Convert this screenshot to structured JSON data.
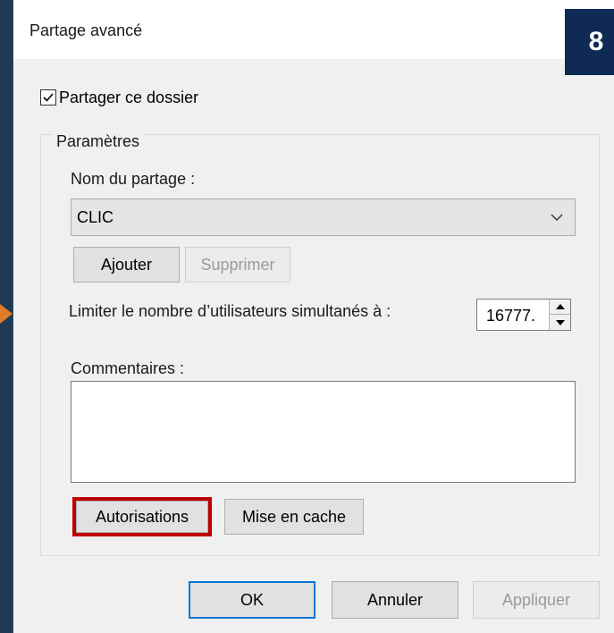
{
  "window": {
    "title": "Partage avancé"
  },
  "badge": {
    "step": "8"
  },
  "share_checkbox": {
    "label": "Partager ce dossier",
    "checked": true
  },
  "group": {
    "legend": "Paramètres"
  },
  "share_name": {
    "label": "Nom du partage :",
    "value": "CLIC"
  },
  "buttons": {
    "add": "Ajouter",
    "remove": "Supprimer",
    "permissions": "Autorisations",
    "caching": "Mise en cache",
    "ok": "OK",
    "cancel": "Annuler",
    "apply": "Appliquer"
  },
  "user_limit": {
    "label": "Limiter le nombre d’utilisateurs simultanés à :",
    "value": "16777."
  },
  "comments": {
    "label": "Commentaires :",
    "value": ""
  },
  "colors": {
    "highlight": "#c00000",
    "badge": "#0e2a55",
    "pointer": "#e07b2a",
    "focus": "#0078d7"
  }
}
